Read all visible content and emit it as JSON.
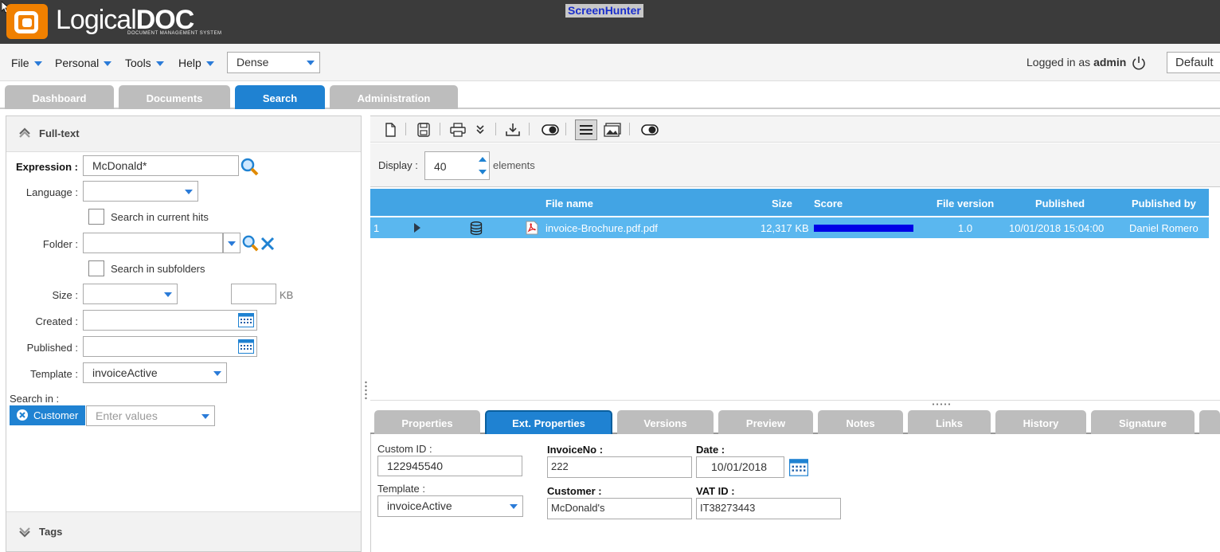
{
  "header": {
    "logo_main": "Logical",
    "logo_doc": "DOC",
    "logo_tagline": "DOCUMENT MANAGEMENT SYSTEM",
    "overlay_badge": "ScreenHunter"
  },
  "menubar": {
    "items": [
      "File",
      "Personal",
      "Tools",
      "Help"
    ],
    "density": "Dense",
    "logged_in_prefix": "Logged in as",
    "logged_in_user": "admin",
    "skin": "Default"
  },
  "tabs": [
    "Dashboard",
    "Documents",
    "Search",
    "Administration"
  ],
  "fulltext": {
    "title": "Full-text",
    "expression_label": "Expression :",
    "expression_value": "McDonald*",
    "language_label": "Language :",
    "language_value": "",
    "search_current_hits": "Search in current hits",
    "folder_label": "Folder :",
    "folder_value": "",
    "search_subfolders": "Search in subfolders",
    "size_label": "Size :",
    "size_value": "",
    "size_unit": "KB",
    "created_label": "Created :",
    "published_label": "Published :",
    "template_label": "Template :",
    "template_value": "invoiceActive",
    "search_in_label": "Search in :",
    "search_in_chip": "Customer",
    "search_in_placeholder": "Enter values",
    "tags_title": "Tags"
  },
  "results": {
    "display_label": "Display :",
    "display_value": "40",
    "elements_label": "elements",
    "columns": {
      "file_name": "File name",
      "size": "Size",
      "score": "Score",
      "file_version": "File version",
      "published": "Published",
      "published_by": "Published by"
    },
    "rows": [
      {
        "index": "1",
        "file_name": "invoice-Brochure.pdf.pdf",
        "size": "12,317 KB",
        "score": 1.0,
        "file_version": "1.0",
        "published": "10/01/2018 15:04:00",
        "published_by": "Daniel Romero"
      }
    ]
  },
  "detail_tabs": [
    "Properties",
    "Ext. Properties",
    "Versions",
    "Preview",
    "Notes",
    "Links",
    "History",
    "Signature"
  ],
  "ext_properties": {
    "custom_id_label": "Custom ID :",
    "custom_id_value": "122945540",
    "template_label": "Template :",
    "template_value": "invoiceActive",
    "invoice_no_label": "InvoiceNo :",
    "invoice_no_value": "222",
    "customer_label": "Customer :",
    "customer_value": "McDonald's",
    "date_label": "Date :",
    "date_value": "10/01/2018",
    "vat_label": "VAT ID :",
    "vat_value": "IT38273443"
  },
  "colors": {
    "accent": "#1f82d2",
    "grid_header": "#42a4e4",
    "grid_row_selected": "#5ab7ef",
    "score_bar": "#0000e6",
    "logo_orange": "#f08000"
  }
}
